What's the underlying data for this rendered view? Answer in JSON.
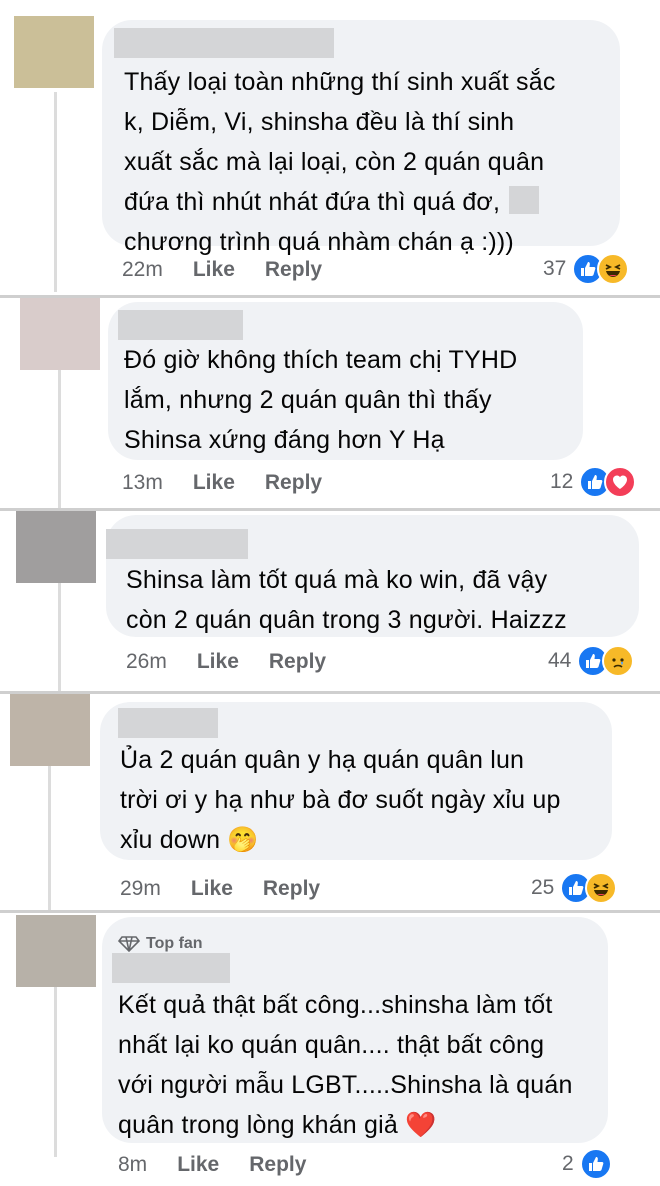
{
  "comments": [
    {
      "lines": [
        "Thấy loại toàn những thí sinh xuất sắc",
        "k, Diễm, Vi, shinsha đều là thí sinh",
        "xuất sắc mà lại loại, còn 2 quán quân",
        "đứa thì nhút nhát đứa thì quá đơ,",
        "chương trình quá nhàm chán ạ :)))"
      ],
      "time": "22m",
      "like": "Like",
      "reply": "Reply",
      "reaction_count": "37",
      "reactions": [
        "like-icon",
        "haha-icon"
      ],
      "avatar_color": "#cbbf98"
    },
    {
      "lines": [
        "Đó giờ không thích team chị TYHD",
        "lắm, nhưng 2 quán quân thì thấy",
        "Shinsa xứng đáng hơn Y Hạ"
      ],
      "time": "13m",
      "like": "Like",
      "reply": "Reply",
      "reaction_count": "12",
      "reactions": [
        "like-icon",
        "love-icon"
      ],
      "avatar_color": "#d9cccb"
    },
    {
      "lines": [
        "Shinsa làm tốt quá mà ko win, đã vậy",
        "còn 2 quán quân trong 3 người. Haizzz"
      ],
      "time": "26m",
      "like": "Like",
      "reply": "Reply",
      "reaction_count": "44",
      "reactions": [
        "like-icon",
        "sad-icon"
      ],
      "avatar_color": "#a09e9e"
    },
    {
      "lines": [
        "Ủa 2 quán quân y hạ quán quân lun",
        "trời ơi y hạ như bà đơ suốt ngày xỉu up",
        "xỉu down 🤭"
      ],
      "time": "29m",
      "like": "Like",
      "reply": "Reply",
      "reaction_count": "25",
      "reactions": [
        "like-icon",
        "haha-icon"
      ],
      "avatar_color": "#beb4a8"
    },
    {
      "badge": "Top fan",
      "lines": [
        "Kết quả thật bất công...shinsha làm tốt",
        "nhất lại ko quán quân.... thật bất công",
        "với người mẫu LGBT.....Shinsha là quán",
        "quân trong lòng khán giả ❤️"
      ],
      "time": "8m",
      "like": "Like",
      "reply": "Reply",
      "reaction_count": "2",
      "reactions": [
        "like-icon"
      ],
      "avatar_color": "#b7b1a8"
    }
  ],
  "colors": {
    "bubble": "#f0f2f5",
    "meta": "#65676b",
    "like_blue": "#1877f2",
    "love_red": "#f33e58",
    "haha_yellow": "#f7b928"
  }
}
